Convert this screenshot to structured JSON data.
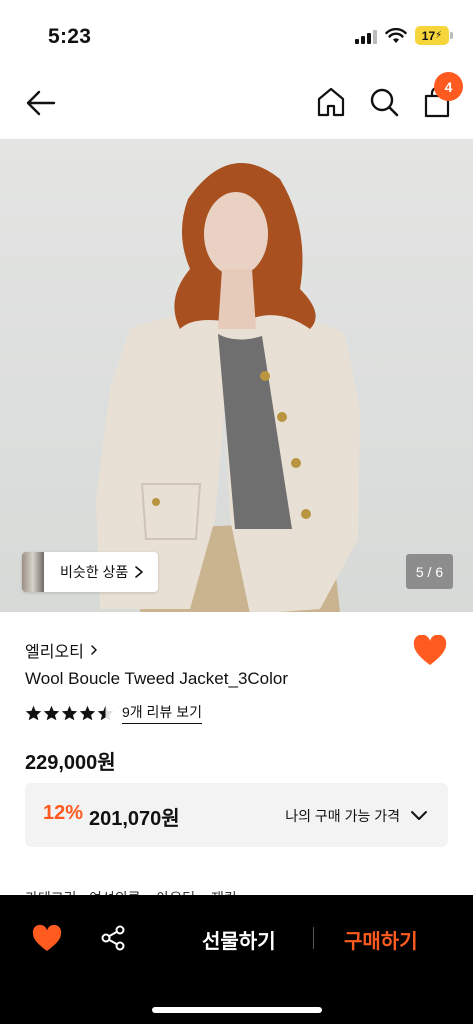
{
  "status_bar": {
    "time": "5:23",
    "battery": "17"
  },
  "nav": {
    "back_icon": "back-arrow-icon",
    "home_icon": "home-icon",
    "search_icon": "search-icon",
    "bag_icon": "shopping-bag-icon",
    "cart_count": "4"
  },
  "hero": {
    "similar_label": "비슷한 상품",
    "counter": "5 / 6"
  },
  "product": {
    "brand": "엘리오티",
    "name": "Wool Boucle Tweed Jacket_3Color",
    "rating": 4.5,
    "reviews_link": "9개 리뷰 보기",
    "original_price": "229,000원",
    "discount": "12%",
    "final_price": "201,070원",
    "my_price_label": "나의 구매 가능 가격",
    "breadcrumb": "카테고리 · 여성의류 > 아우터 > 재킷"
  },
  "bottom_bar": {
    "gift_label": "선물하기",
    "buy_label": "구매하기"
  },
  "colors": {
    "accent": "#ff5a1f",
    "bottom_bar": "#000000"
  }
}
